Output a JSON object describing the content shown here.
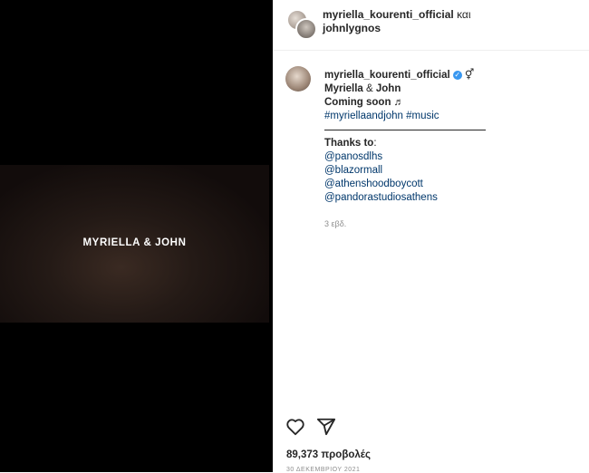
{
  "video": {
    "title": "MYRIELLA & JOHN"
  },
  "header": {
    "author": "myriella_kourenti_official",
    "conjunction": "και",
    "coauthor": "johnlygnos"
  },
  "caption": {
    "username": "myriella_kourenti_official",
    "verified_glyph": "✓",
    "gender_symbol": "⚥",
    "name1": "Myriella",
    "amp": " & ",
    "name2": "John",
    "coming": "Coming soon ♬",
    "hashtags": "#myriellaandjohn #music",
    "thanks_label": "Thanks to",
    "thanks_colon": ":",
    "mentions": [
      "@panosdlhs",
      "@blazormall",
      "@athenshoodboycott",
      "@pandorastudiosathens"
    ],
    "time_ago": "3 εβδ."
  },
  "actions": {
    "like_icon": "heart-icon",
    "share_icon": "send-icon"
  },
  "stats": {
    "views": "89,373 προβολές",
    "date": "30 ΔΕΚΕΜΒΡΙΟΥ 2021"
  }
}
